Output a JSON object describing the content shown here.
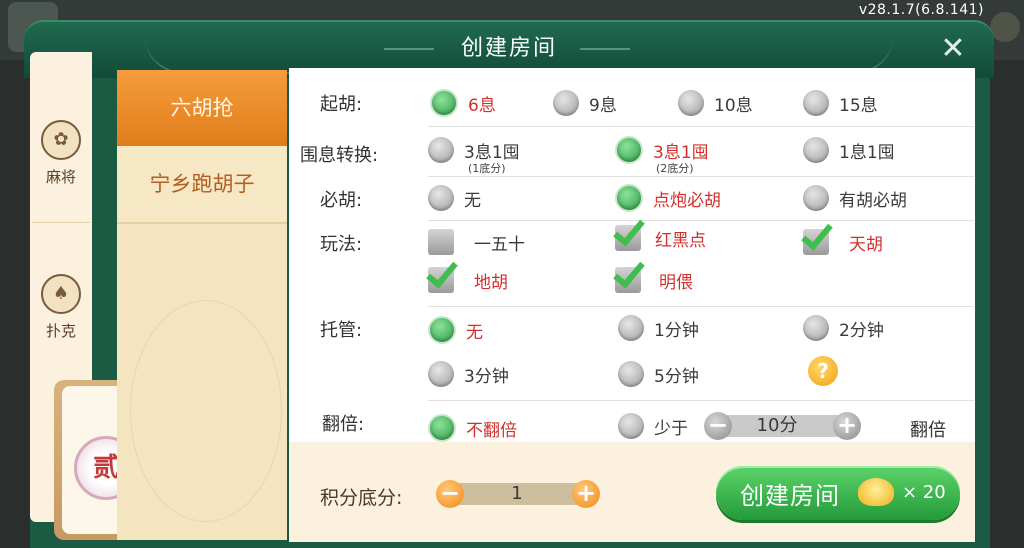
{
  "version": "v28.1.7(6.8.141)",
  "dialog": {
    "title": "创建房间"
  },
  "categories": [
    {
      "label": "麻将",
      "icon": "mahjong-flower-icon"
    },
    {
      "label": "扑克",
      "icon": "spade-icon"
    }
  ],
  "active_medal": "贰",
  "games": [
    {
      "label": "六胡抢",
      "active": true
    },
    {
      "label": "宁乡跑胡子",
      "active": false
    }
  ],
  "options": {
    "qihu": {
      "label": "起胡:",
      "choices": [
        "6息",
        "9息",
        "10息",
        "15息"
      ],
      "selected": "6息"
    },
    "weixi": {
      "label": "围息转换:",
      "choices": [
        "3息1囤",
        "3息1囤",
        "1息1囤"
      ],
      "subs": [
        "(1底分)",
        "(2底分)"
      ],
      "selected_index": 1
    },
    "bihu": {
      "label": "必胡:",
      "choices": [
        "无",
        "点炮必胡",
        "有胡必胡"
      ],
      "selected": "点炮必胡"
    },
    "wanfa": {
      "label": "玩法:",
      "choices": [
        {
          "label": "一五十",
          "checked": false
        },
        {
          "label": "红黑点",
          "checked": true
        },
        {
          "label": "天胡",
          "checked": true
        },
        {
          "label": "地胡",
          "checked": true
        },
        {
          "label": "明偎",
          "checked": true
        }
      ]
    },
    "tuoguan": {
      "label": "托管:",
      "choices": [
        "无",
        "1分钟",
        "2分钟",
        "3分钟",
        "5分钟"
      ],
      "selected": "无",
      "help": "?"
    },
    "fanbei": {
      "label": "翻倍:",
      "choices": [
        "不翻倍",
        "少于"
      ],
      "selected": "不翻倍",
      "threshold": "10分",
      "suffix": "翻倍"
    }
  },
  "score": {
    "label": "积分底分:",
    "value": "1"
  },
  "create": {
    "label": "创建房间",
    "cost": "× 20"
  },
  "colors": {
    "header": "#1f6a4f",
    "accent_orange": "#f08a17",
    "selected_red": "#d2302b",
    "button_green": "#249b3a"
  }
}
